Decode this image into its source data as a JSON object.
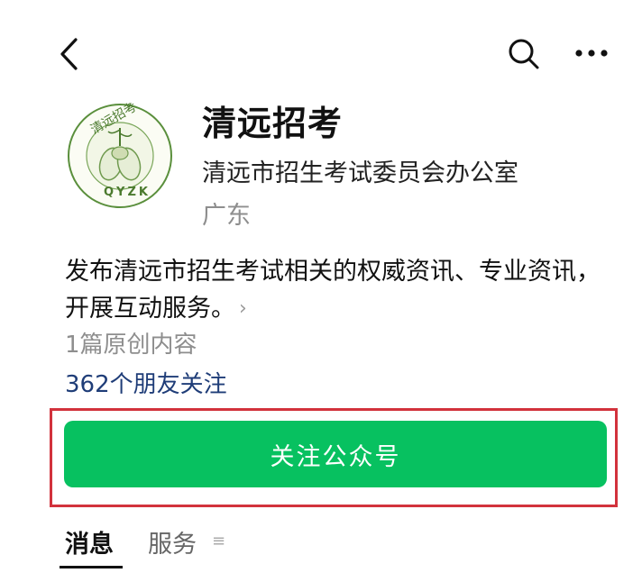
{
  "account": {
    "name": "清远招考",
    "organization": "清远市招生考试委员会办公室",
    "region": "广东",
    "logo_text": {
      "top": "清远招考",
      "bottom": "QYZK"
    },
    "description": "发布清远市招生考试相关的权威资讯、专业资讯，开展互动服务。",
    "article_count": "1篇原创内容",
    "friends_following": "362个朋友关注"
  },
  "actions": {
    "follow_label": "关注公众号"
  },
  "tabs": [
    {
      "label": "消息",
      "active": true
    },
    {
      "label": "服务",
      "active": false
    }
  ],
  "icons": {
    "back": "chevron-left-icon",
    "search": "search-icon",
    "more": "more-dots-icon",
    "expand": "chevron-right-icon",
    "menu": "menu-lines-icon"
  },
  "colors": {
    "accent": "#07c160",
    "link": "#1f3d78",
    "highlight": "#d2323c",
    "muted": "#8e8e8e"
  }
}
